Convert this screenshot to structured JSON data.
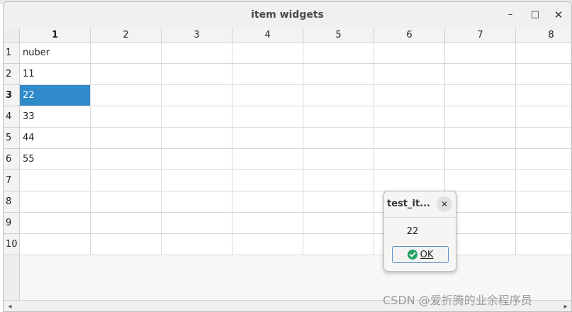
{
  "window": {
    "title": "item widgets",
    "minimize_glyph": "–",
    "maximize_glyph": "□",
    "close_glyph": "✕"
  },
  "table": {
    "column_headers": [
      "1",
      "2",
      "3",
      "4",
      "5",
      "6",
      "7",
      "8"
    ],
    "row_headers": [
      "1",
      "2",
      "3",
      "4",
      "5",
      "6",
      "7",
      "8",
      "9",
      "10"
    ],
    "active_column": 0,
    "active_row": 2,
    "selected_cell": {
      "row": 2,
      "col": 0
    },
    "cells": [
      [
        "nuber",
        "",
        "",
        "",
        "",
        "",
        "",
        ""
      ],
      [
        "11",
        "",
        "",
        "",
        "",
        "",
        "",
        ""
      ],
      [
        "22",
        "",
        "",
        "",
        "",
        "",
        "",
        ""
      ],
      [
        "33",
        "",
        "",
        "",
        "",
        "",
        "",
        ""
      ],
      [
        "44",
        "",
        "",
        "",
        "",
        "",
        "",
        ""
      ],
      [
        "55",
        "",
        "",
        "",
        "",
        "",
        "",
        ""
      ],
      [
        "",
        "",
        "",
        "",
        "",
        "",
        "",
        ""
      ],
      [
        "",
        "",
        "",
        "",
        "",
        "",
        "",
        ""
      ],
      [
        "",
        "",
        "",
        "",
        "",
        "",
        "",
        ""
      ],
      [
        "",
        "",
        "",
        "",
        "",
        "",
        "",
        ""
      ]
    ],
    "selection_color": "#2f8ac9"
  },
  "scrollbar": {
    "left_arrow": "◂",
    "right_arrow": "▸"
  },
  "dialog": {
    "title": "test_it...",
    "close_glyph": "✕",
    "message": "22",
    "ok_label": "OK",
    "ok_icon": "check-circle-icon",
    "ok_icon_color": "#26a269"
  },
  "watermark": "CSDN @爱折腾的业余程序员"
}
